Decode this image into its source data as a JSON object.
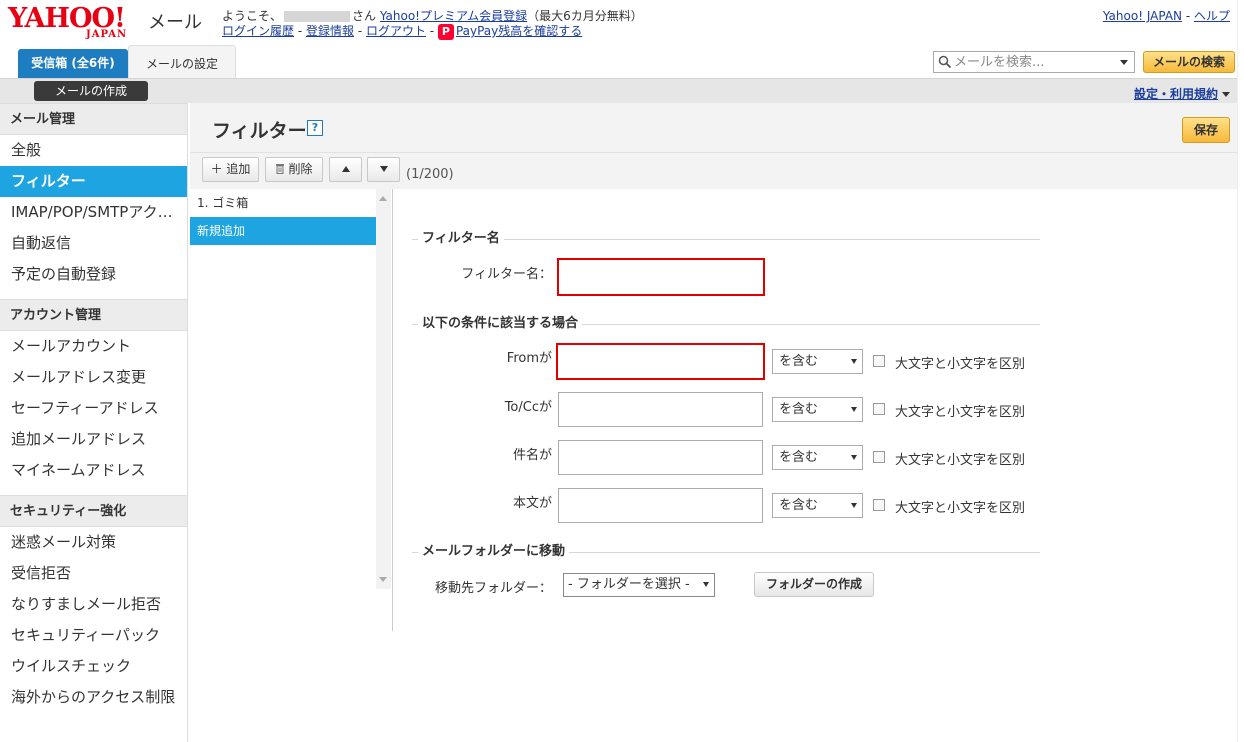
{
  "header": {
    "logo_text": "YAHOO!",
    "logo_sub": "JAPAN",
    "app_name": "メール",
    "welcome_prefix": "ようこそ、",
    "welcome_suffix": "さん",
    "premium_link": "Yahoo!プレミアム会員登録",
    "premium_note": "（最大6カ月分無料）",
    "login_history": "ログイン履歴",
    "registration_info": "登録情報",
    "logout": "ログアウト",
    "paypay_icon": "P",
    "paypay_link": "PayPay残高を確認する",
    "sep": " - ",
    "yahoo_japan_link": "Yahoo! JAPAN",
    "help_link": "ヘルプ"
  },
  "tabs": {
    "inbox": "受信箱 (全6件)",
    "settings": "メールの設定"
  },
  "search": {
    "placeholder": "メールを検索...",
    "button": "メールの検索"
  },
  "band": {
    "compose": "メールの作成",
    "settings_terms": "設定・利用規約"
  },
  "sidebar": {
    "sections": [
      {
        "title": "メール管理",
        "items": [
          "全般",
          "フィルター",
          "IMAP/POP/SMTPアク…",
          "自動返信",
          "予定の自動登録"
        ]
      },
      {
        "title": "アカウント管理",
        "items": [
          "メールアカウント",
          "メールアドレス変更",
          "セーフティーアドレス",
          "追加メールアドレス",
          "マイネームアドレス"
        ]
      },
      {
        "title": "セキュリティー強化",
        "items": [
          "迷惑メール対策",
          "受信拒否",
          "なりすましメール拒否",
          "セキュリティーパック",
          "ウイルスチェック",
          "海外からのアクセス制限"
        ]
      }
    ]
  },
  "page": {
    "title": "フィルター",
    "help_icon": "?",
    "save": "保存"
  },
  "toolbar": {
    "add": "＋ 追加",
    "delete": "削除",
    "count": "(1/200)"
  },
  "filter_list": [
    "1. ゴミ箱",
    "新規追加"
  ],
  "form": {
    "section_name": "フィルター名",
    "name_label": "フィルター名：",
    "name_value": "",
    "section_conditions": "以下の条件に該当する場合",
    "conditions": [
      {
        "label": "Fromが",
        "value": "",
        "match": "を含む",
        "case_label": "大文字と小文字を区別"
      },
      {
        "label": "To/Ccが",
        "value": "",
        "match": "を含む",
        "case_label": "大文字と小文字を区別"
      },
      {
        "label": "件名が",
        "value": "",
        "match": "を含む",
        "case_label": "大文字と小文字を区別"
      },
      {
        "label": "本文が",
        "value": "",
        "match": "を含む",
        "case_label": "大文字と小文字を区別"
      }
    ],
    "section_move": "メールフォルダーに移動",
    "dest_label": "移動先フォルダー：",
    "dest_value": "- フォルダーを選択 -",
    "create_folder": "フォルダーの作成"
  },
  "colors": {
    "accent_blue": "#1ea4e0",
    "tab_blue": "#1e7cc1",
    "yahoo_red": "#e60012",
    "highlight_red": "#e00000",
    "button_yellow": "#f6b93a"
  },
  "icons": [
    "search-icon",
    "trash-icon",
    "help-icon",
    "paypay-icon",
    "chevron-down-icon",
    "arrow-up-icon",
    "arrow-down-icon"
  ]
}
